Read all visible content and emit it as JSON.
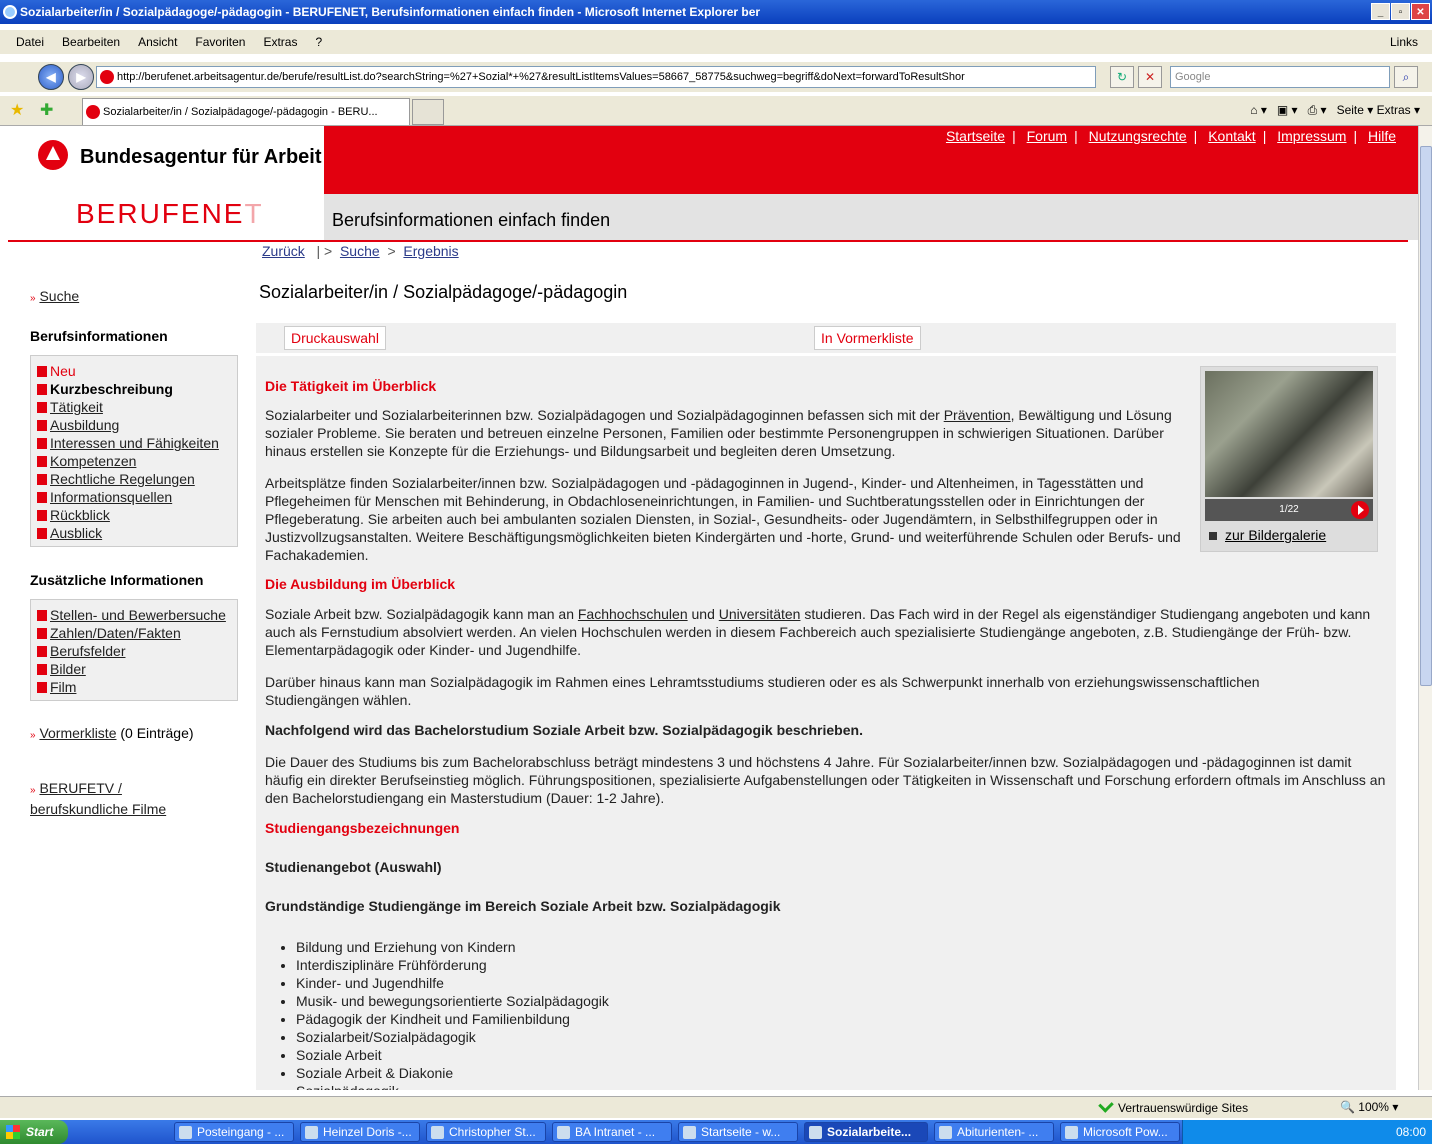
{
  "window": {
    "title": "Sozialarbeiter/in / Sozialpädagoge/-pädagogin - BERUFENET, Berufsinformationen einfach finden - Microsoft Internet Explorer ber"
  },
  "menu": {
    "items": [
      "Datei",
      "Bearbeiten",
      "Ansicht",
      "Favoriten",
      "Extras",
      "?"
    ],
    "links": "Links"
  },
  "address": {
    "url": "http://berufenet.arbeitsagentur.de/berufe/resultList.do?searchString=%27+Sozial*+%27&resultListItemsValues=58667_58775&suchweg=begriff&doNext=forwardToResultShor",
    "search_placeholder": "Google"
  },
  "tabs": {
    "active": "Sozialarbeiter/in / Sozialpädagoge/-pädagogin - BERU...",
    "tools": "Seite ▾   Extras ▾"
  },
  "header": {
    "brand": "Bundesagentur für Arbeit",
    "logo_main": "BERUFENE",
    "logo_light": "T",
    "tagline": "Berufsinformationen einfach finden",
    "links": [
      "Startseite",
      "Forum",
      "Nutzungsrechte",
      "Kontakt",
      "Impressum",
      "Hilfe"
    ]
  },
  "breadcrumb": {
    "back": "Zurück",
    "sep1": "|  >",
    "search": "Suche",
    "sep2": ">",
    "result": "Ergebnis"
  },
  "sidebar": {
    "search": "Suche",
    "section1": "Berufsinformationen",
    "items1": [
      "Neu",
      "Kurzbeschreibung",
      "Tätigkeit",
      "Ausbildung",
      "Interessen und Fähigkeiten",
      "Kompetenzen",
      "Rechtliche Regelungen",
      "Informationsquellen",
      "Rückblick",
      "Ausblick"
    ],
    "section2": "Zusätzliche Informationen",
    "items2": [
      "Stellen- und Bewerbersuche",
      "Zahlen/Daten/Fakten",
      "Berufsfelder",
      "Bilder",
      "Film"
    ],
    "vormerk_link": "Vormerkliste",
    "vormerk_count": "(0 Einträge)",
    "berufetv_1": "BERUFETV /",
    "berufetv_2": "berufskundliche Filme"
  },
  "main": {
    "title": "Sozialarbeiter/in / Sozialpädagoge/-pädagogin",
    "btn_print": "Druckauswahl",
    "btn_mark": "In Vormerkliste",
    "h1": "Die Tätigkeit im Überblick",
    "p1a": "Sozialarbeiter und Sozialarbeiterinnen bzw. Sozialpädagogen und Sozialpädagoginnen befassen sich mit der ",
    "p1link": "Prävention",
    "p1b": ", Bewältigung und Lösung sozialer Probleme. Sie beraten und betreuen einzelne Personen, Familien oder bestimmte Personengruppen in schwierigen Situationen. Darüber hinaus erstellen sie Konzepte für die Erziehungs- und Bildungsarbeit und begleiten deren Umsetzung.",
    "p2": "Arbeitsplätze finden Sozialarbeiter/innen bzw. Sozialpädagogen und -pädagoginnen in Jugend-, Kinder- und Altenheimen, in Tagesstätten und Pflegeheimen für Menschen mit Behinderung, in Obdachloseneinrichtungen, in Familien- und Suchtberatungsstellen oder in Einrichtungen der Pflegeberatung. Sie arbeiten auch bei ambulanten sozialen Diensten, in Sozial-, Gesundheits- oder Jugendämtern, in Selbsthilfegruppen oder in Justizvollzugsanstalten. Weitere Beschäftigungsmöglichkeiten bieten Kindergärten und -horte, Grund- und weiterführende Schulen oder Berufs- und Fachakademien.",
    "h2": "Die Ausbildung im Überblick",
    "p3a": "Soziale Arbeit bzw. Sozialpädagogik kann man an ",
    "p3link1": "Fachhochschulen",
    "p3b": " und ",
    "p3link2": "Universitäten",
    "p3c": " studieren. Das Fach wird in der Regel als eigenständiger Studiengang angeboten und kann auch als Fernstudium absolviert werden. An vielen Hochschulen werden in diesem Fachbereich auch spezialisierte Studiengänge angeboten, z.B. Studiengänge der Früh- bzw. Elementarpädagogik oder Kinder- und Jugendhilfe.",
    "p4": "Darüber hinaus kann man Sozialpädagogik im Rahmen eines Lehramtsstudiums studieren oder es als Schwerpunkt innerhalb von erziehungswissenschaftlichen Studiengängen wählen.",
    "b1": "Nachfolgend wird das Bachelorstudium Soziale Arbeit bzw. Sozialpädagogik beschrieben.",
    "p5": "Die Dauer des Studiums bis zum Bachelorabschluss beträgt mindestens 3 und höchstens 4 Jahre. Für Sozialarbeiter/innen bzw. Sozialpädagogen und -pädagoginnen ist damit häufig ein direkter Berufseinstieg möglich. Führungspositionen, spezialisierte Aufgabenstellungen oder Tätigkeiten in Wissenschaft und Forschung erfordern oftmals im Anschluss an den Bachelorstudiengang ein Masterstudium (Dauer: 1-2 Jahre).",
    "h3": "Studiengangsbezeichnungen",
    "b2": "Studienangebot (Auswahl)",
    "b3": "Grundständige Studiengänge im Bereich Soziale Arbeit bzw. Sozialpädagogik",
    "list": [
      "Bildung und Erziehung von Kindern",
      "Interdisziplinäre Frühförderung",
      "Kinder- und Jugendhilfe",
      "Musik- und bewegungsorientierte Sozialpädagogik",
      "Pädagogik der Kindheit und Familienbildung",
      "Sozialarbeit/Sozialpädagogik",
      "Soziale Arbeit",
      "Soziale Arbeit & Diakonie",
      "Sozialpädagogik"
    ],
    "photo_counter": "1/22",
    "gallery": "zur Bildergalerie"
  },
  "status": {
    "zone": "Vertrauenswürdige Sites",
    "zoom": "100%"
  },
  "taskbar": {
    "start": "Start",
    "tasks": [
      "Posteingang - ...",
      "Heinzel Doris -...",
      "Christopher St...",
      "BA Intranet - ...",
      "Startseite - w...",
      "Sozialarbeite...",
      "Abiturienten- ...",
      "Microsoft Pow..."
    ],
    "clock": "08:00"
  }
}
